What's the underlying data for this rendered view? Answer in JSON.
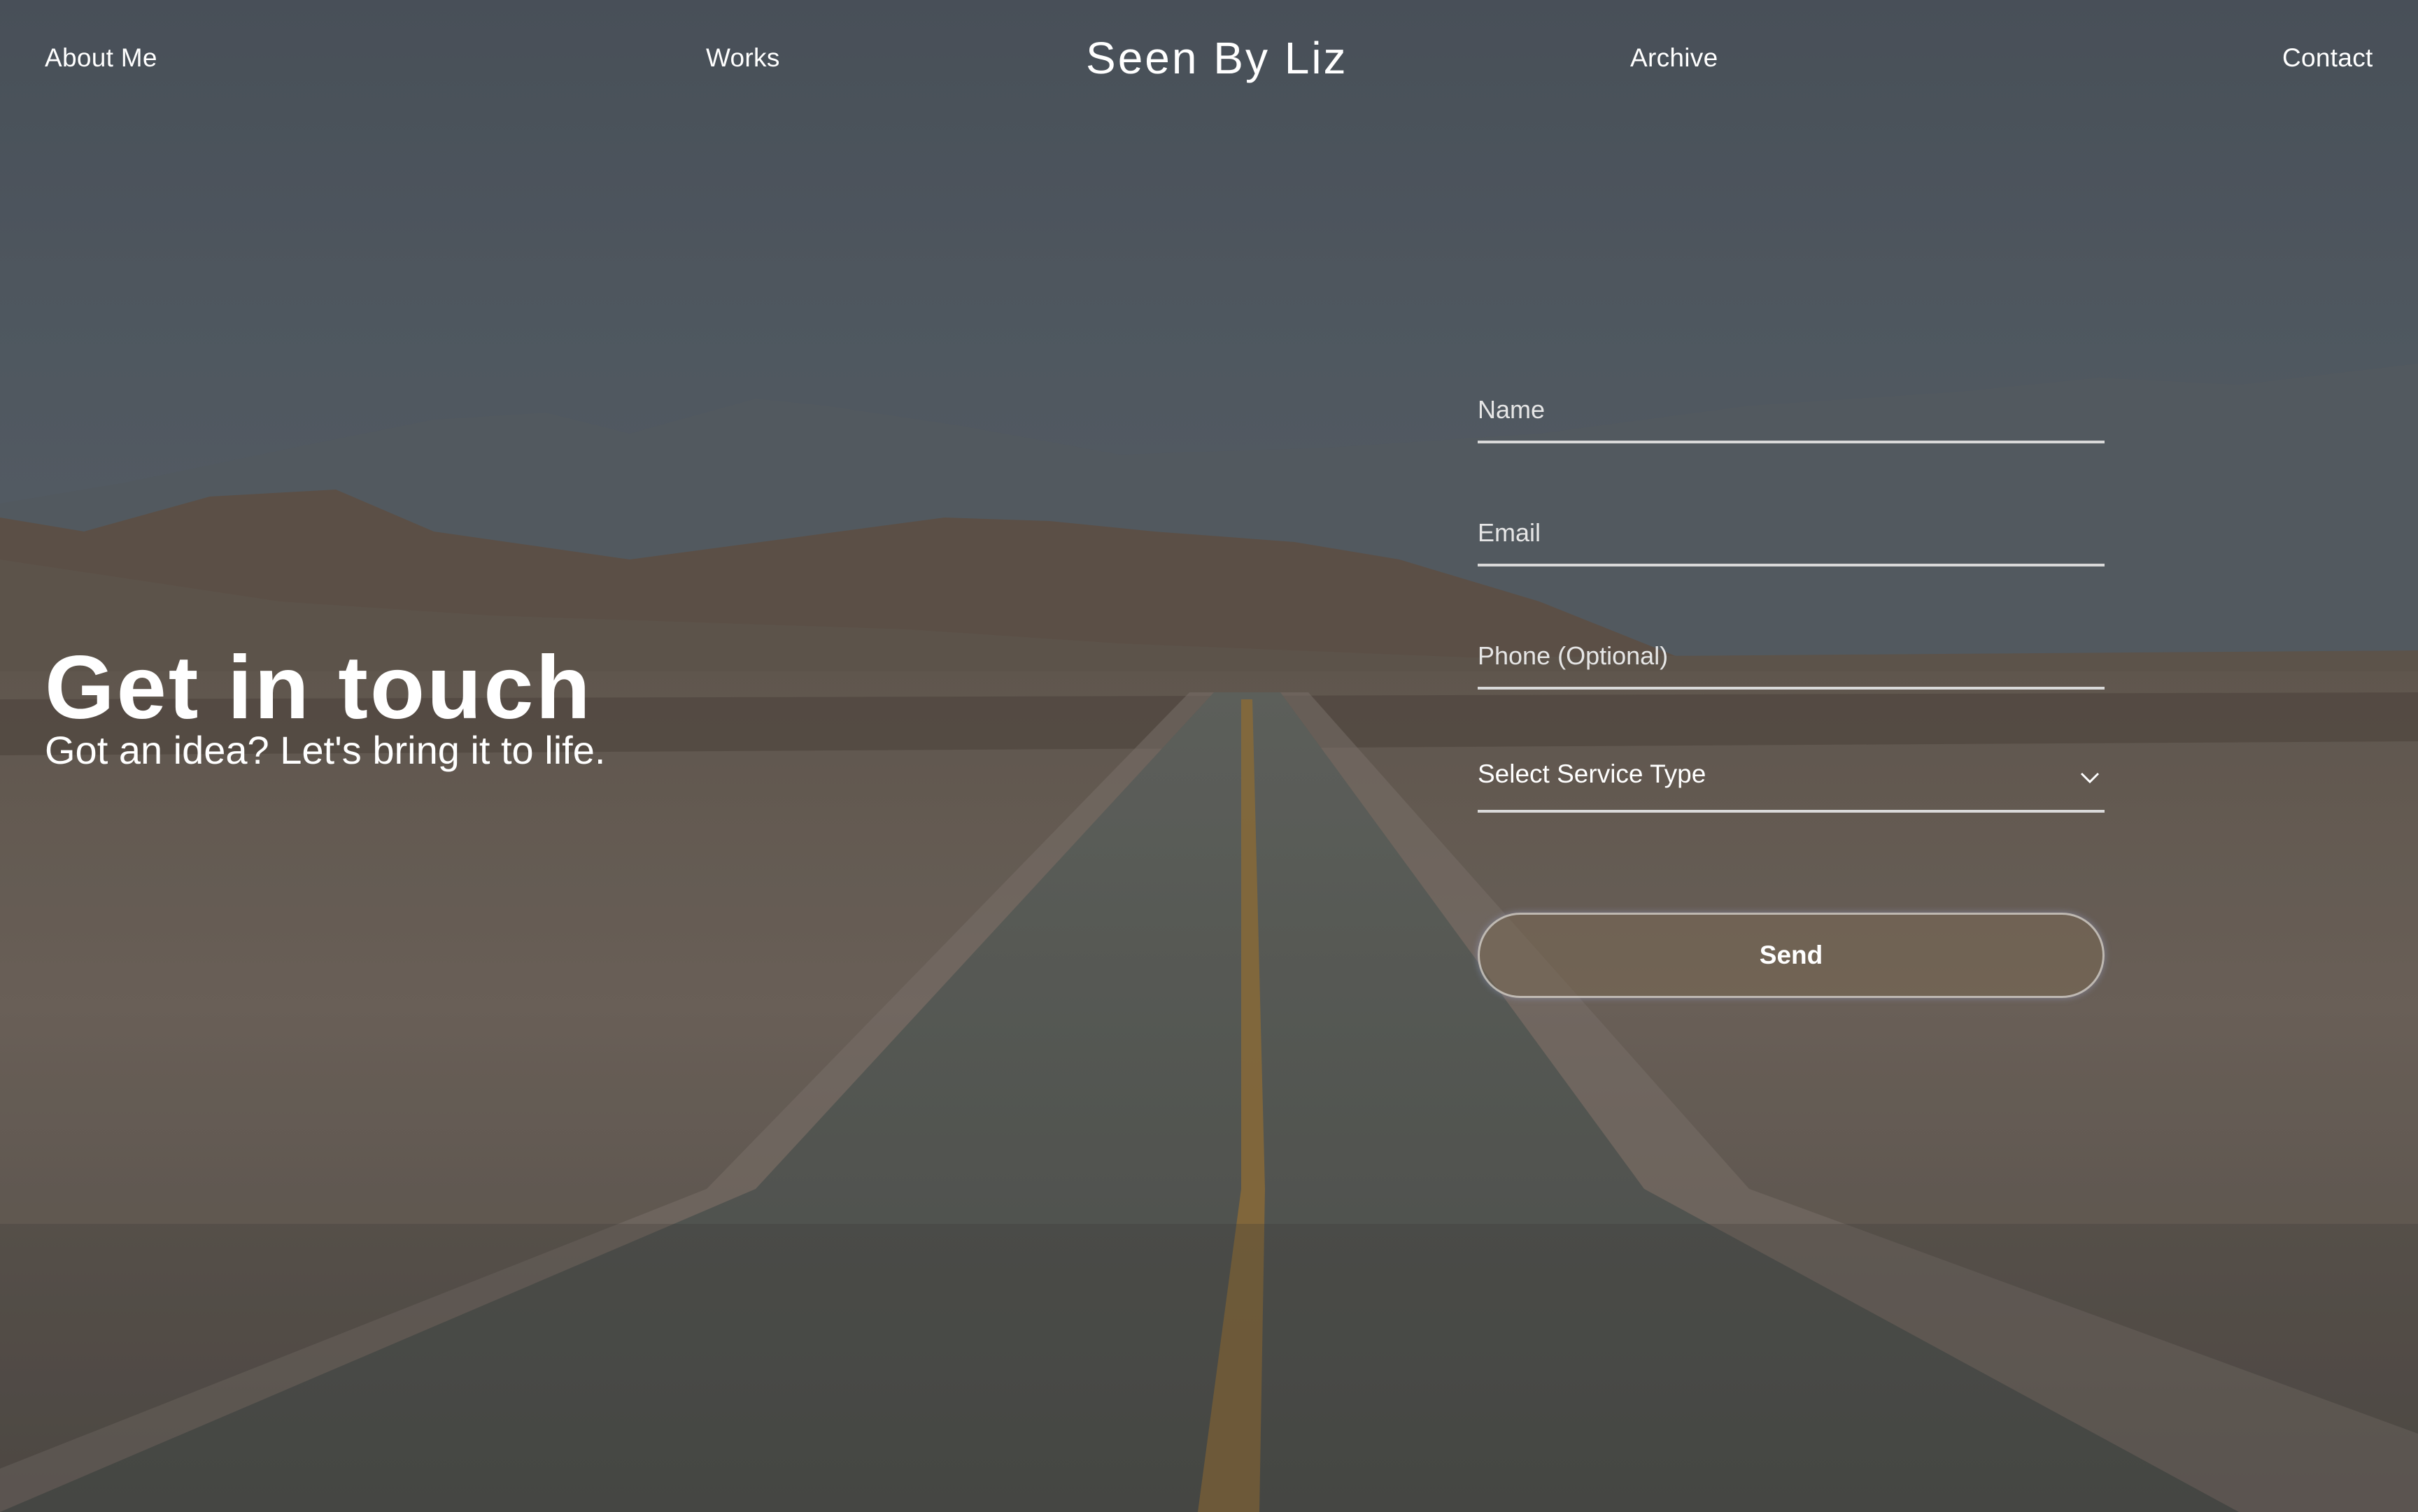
{
  "header": {
    "brand": "Seen By Liz",
    "nav": {
      "about": "About Me",
      "works": "Works",
      "archive": "Archive",
      "contact": "Contact"
    }
  },
  "hero": {
    "title": "Get in touch",
    "subtitle": "Got an idea? Let's bring it to life."
  },
  "form": {
    "name_placeholder": "Name",
    "email_placeholder": "Email",
    "phone_placeholder": "Phone (Optional)",
    "service_select": "Select Service Type",
    "service_icon": "chevron-down-icon",
    "send_label": "Send"
  },
  "colors": {
    "text": "#ffffff",
    "underline": "#d9d9d9",
    "send_fill": "#786854"
  }
}
